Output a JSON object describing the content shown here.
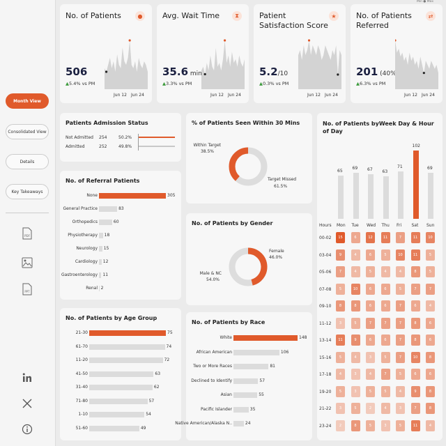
{
  "legend_hint": "Min ● Max",
  "nav": {
    "month_view": "Month View",
    "consolidated_view": "Consolidated View",
    "details": "Details",
    "key_takeaways": "Key Takeaways",
    "pdf_label": "PDF",
    "ppt_label": "PPT"
  },
  "kpis": [
    {
      "title": "No. of Patients",
      "value": "506",
      "unit": "",
      "delta": "5.4% vs PM",
      "x_start": "Jun 12",
      "x_end": "Jun 24",
      "icon": "user-icon",
      "trend": [
        6,
        5,
        7,
        9,
        6,
        8,
        5,
        10,
        7,
        6,
        12,
        8,
        7,
        9,
        14,
        7,
        6,
        8,
        5,
        9,
        7,
        6,
        8,
        7,
        5
      ]
    },
    {
      "title": "Avg. Wait Time",
      "value": "35.6",
      "unit": " min",
      "delta": "3.3% vs PM",
      "x_start": "Jun 12",
      "x_end": "Jun 24",
      "icon": "hourglass-icon",
      "trend": [
        5,
        6,
        4,
        7,
        5,
        9,
        6,
        5,
        11,
        6,
        7,
        5,
        8,
        13,
        7,
        9,
        6,
        10,
        7,
        8,
        6,
        9,
        7,
        6,
        8
      ]
    },
    {
      "title": "Patient Satisfaction Score",
      "value": "5.2",
      "unit": "/10",
      "delta": "0.3% vs PM",
      "x_start": "Jun 12",
      "x_end": "Jun 24",
      "icon": "star-icon",
      "trend": [
        7,
        8,
        6,
        9,
        7,
        8,
        10,
        7,
        9,
        8,
        7,
        9,
        8,
        6,
        7,
        9,
        8,
        7,
        6,
        8,
        7,
        9,
        3,
        8,
        7
      ]
    },
    {
      "title": "No. of Patients Referred",
      "value": "201",
      "unit": " (40%)",
      "delta": "6.3% vs PM",
      "x_start": "Jun 12",
      "x_end": "Jun 24",
      "icon": "referral-icon",
      "trend": [
        12,
        9,
        10,
        8,
        9,
        7,
        8,
        6,
        9,
        7,
        8,
        6,
        7,
        5,
        8,
        6,
        4,
        7,
        6,
        5,
        7,
        6,
        5,
        6,
        4
      ]
    }
  ],
  "admission": {
    "title": "Patients Admission Status",
    "rows": [
      {
        "label": "Not Admitted",
        "count": "254",
        "pct": "50.2%",
        "value": 50.2
      },
      {
        "label": "Admitted",
        "count": "252",
        "pct": "49.8%",
        "value": 49.8
      }
    ]
  },
  "seen30": {
    "title": "% of Patients Seen Within 30 Mins",
    "within_label": "Within Target",
    "within_pct": "38.5%",
    "within": 38.5,
    "missed_label": "Target Missed",
    "missed_pct": "61.5%",
    "missed": 61.5
  },
  "gender": {
    "title": "No. of Patients by Gender",
    "female_label": "Female",
    "female_pct": "46.0%",
    "female": 46.0,
    "male_label": "Male & NC",
    "male_pct": "54.0%",
    "male": 54.0
  },
  "referral": {
    "title": "No. of Referral Patients",
    "items": [
      {
        "label": "None",
        "value": 305
      },
      {
        "label": "General Practice",
        "value": 83
      },
      {
        "label": "Orthopedics",
        "value": 60
      },
      {
        "label": "Physiotherapy",
        "value": 18
      },
      {
        "label": "Neurology",
        "value": 15
      },
      {
        "label": "Cardiology",
        "value": 12
      },
      {
        "label": "Gastroenterology",
        "value": 11
      },
      {
        "label": "Renal",
        "value": 2
      }
    ]
  },
  "age": {
    "title": "No. of Patients by Age Group",
    "items": [
      {
        "label": "21-30",
        "value": 75
      },
      {
        "label": "61-70",
        "value": 74
      },
      {
        "label": "11-20",
        "value": 72
      },
      {
        "label": "41-50",
        "value": 63
      },
      {
        "label": "31-40",
        "value": 62
      },
      {
        "label": "71-80",
        "value": 57
      },
      {
        "label": "1-10",
        "value": 54
      },
      {
        "label": "51-60",
        "value": 49
      }
    ]
  },
  "race": {
    "title": "No. of Patients by Race",
    "items": [
      {
        "label": "White",
        "value": 148
      },
      {
        "label": "African American",
        "value": 106
      },
      {
        "label": "Two or More Races",
        "value": 81
      },
      {
        "label": "Declined to Identify",
        "value": 57
      },
      {
        "label": "Asian",
        "value": 55
      },
      {
        "label": "Pacific Islander",
        "value": 35
      },
      {
        "label": "Native American/Alaska N..",
        "value": 24
      }
    ]
  },
  "chart_data": {
    "type": "heatmap",
    "title": "No. of Patients byWeek Day & Hour of Day",
    "hours_label": "Hours",
    "days": [
      "Mon",
      "Tue",
      "Wed",
      "Thu",
      "Fri",
      "Sat",
      "Sun"
    ],
    "day_totals": [
      65,
      69,
      67,
      63,
      71,
      102,
      69
    ],
    "hours": [
      "00-02",
      "03-04",
      "05-06",
      "07-08",
      "09-10",
      "11-12",
      "13-14",
      "15-16",
      "17-18",
      "19-20",
      "21-22",
      "23-24"
    ],
    "matrix": [
      [
        15,
        6,
        12,
        11,
        7,
        11,
        10
      ],
      [
        9,
        4,
        6,
        5,
        10,
        11,
        5
      ],
      [
        7,
        4,
        5,
        4,
        4,
        8,
        5
      ],
      [
        5,
        10,
        6,
        6,
        5,
        7,
        7
      ],
      [
        8,
        8,
        6,
        6,
        7,
        6,
        4
      ],
      [
        3,
        5,
        7,
        7,
        7,
        8,
        6
      ],
      [
        11,
        9,
        6,
        6,
        7,
        8,
        6
      ],
      [
        5,
        4,
        3,
        5,
        7,
        10,
        8
      ],
      [
        4,
        3,
        4,
        7,
        5,
        6,
        6
      ],
      [
        5,
        3,
        5,
        5,
        4,
        9,
        8
      ],
      [
        3,
        5,
        2,
        4,
        3,
        7,
        8
      ],
      [
        2,
        8,
        5,
        3,
        5,
        11,
        4
      ]
    ],
    "colors": {
      "accent": "#e05a2b",
      "light": "#f5dcd2",
      "bar": "#dcdcdc"
    }
  }
}
